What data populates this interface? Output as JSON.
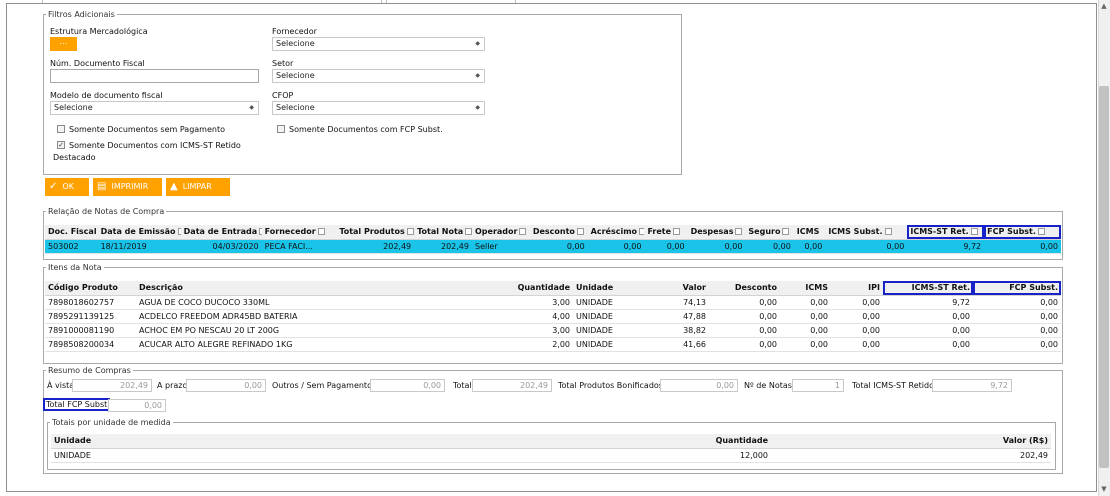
{
  "filters": {
    "legend": "Filtros Adicionais",
    "estrutura_label": "Estrutura Mercadológica",
    "estrutura_button": "...",
    "fornecedor_label": "Fornecedor",
    "fornecedor_value": "Selecione",
    "num_doc_label": "Núm. Documento Fiscal",
    "num_doc_value": "",
    "setor_label": "Setor",
    "setor_value": "Selecione",
    "modelo_label": "Modelo de documento fiscal",
    "modelo_value": "Selecione",
    "cfop_label": "CFOP",
    "cfop_value": "Selecione",
    "chk_sem_pagamento": "Somente Documentos sem Pagamento",
    "chk_fcp_subst": "Somente Documentos com FCP Subst.",
    "chk_icms_st_line1": "Somente Documentos com ICMS-ST Retido",
    "chk_icms_st_line2": "Destacado",
    "ok_label": "OK",
    "imprimir_label": "IMPRIMIR",
    "limpar_label": "LIMPAR"
  },
  "notas": {
    "legend": "Relação de Notas de Compra",
    "columns": [
      "Doc. Fiscal",
      "Data de Emissão",
      "Data de Entrada",
      "Fornecedor",
      "Total Produtos",
      "Total Nota",
      "Operador",
      "Desconto",
      "Acréscimo",
      "Frete",
      "Despesas",
      "Seguro",
      "ICMS",
      "ICMS Subst.",
      "ICMS-ST Ret.",
      "FCP Subst."
    ],
    "row": [
      "503002",
      "18/11/2019",
      "04/03/2020",
      "PECA FACI...",
      "202,49",
      "202,49",
      "Seller",
      "0,00",
      "0,00",
      "0,00",
      "0,00",
      "0,00",
      "0,00",
      "0,00",
      "9,72",
      "0,00"
    ]
  },
  "itens": {
    "legend": "Itens da Nota",
    "columns": [
      "Código Produto",
      "Descrição",
      "Quantidade",
      "Unidade",
      "Valor",
      "Desconto",
      "ICMS",
      "IPI",
      "ICMS-ST Ret.",
      "FCP Subst."
    ],
    "rows": [
      [
        "7898018602757",
        "AGUA DE COCO DUCOCO 330ML",
        "3,00",
        "UNIDADE",
        "74,13",
        "0,00",
        "0,00",
        "0,00",
        "9,72",
        "0,00"
      ],
      [
        "7895291139125",
        "ACDELCO FREEDOM ADR45BD BATERIA",
        "4,00",
        "UNIDADE",
        "47,88",
        "0,00",
        "0,00",
        "0,00",
        "0,00",
        "0,00"
      ],
      [
        "7891000081190",
        "ACHOC EM PO NESCAU 20 LT 200G",
        "3,00",
        "UNIDADE",
        "38,82",
        "0,00",
        "0,00",
        "0,00",
        "0,00",
        "0,00"
      ],
      [
        "7898508200034",
        "ACUCAR ALTO ALEGRE REFINADO 1KG",
        "2,00",
        "UNIDADE",
        "41,66",
        "0,00",
        "0,00",
        "0,00",
        "0,00",
        "0,00"
      ]
    ]
  },
  "resumo": {
    "legend": "Resumo de Compras",
    "avista_label": "À vista",
    "avista_value": "202,49",
    "aprazo_label": "A prazo",
    "aprazo_value": "0,00",
    "outros_label": "Outros / Sem Pagamento",
    "outros_value": "0,00",
    "total_label": "Total",
    "total_value": "202,49",
    "bonificados_label": "Total Produtos Bonificados",
    "bonificados_value": "0,00",
    "notas_label": "Nº de Notas",
    "notas_value": "1",
    "icms_st_label": "Total ICMS-ST Retido",
    "icms_st_value": "9,72",
    "fcp_label": "Total FCP Subst",
    "fcp_value": "0,00"
  },
  "unidade": {
    "legend": "Totais por unidade de medida",
    "col_unidade": "Unidade",
    "col_quantidade": "Quantidade",
    "col_valor": "Valor (R$)",
    "row_unidade": "UNIDADE",
    "row_quantidade": "12,000",
    "row_valor": "202,49"
  },
  "colors": {
    "accent_orange": "#ffa200",
    "selected_row": "#1ac3e8",
    "highlight_border": "#1722c8"
  }
}
